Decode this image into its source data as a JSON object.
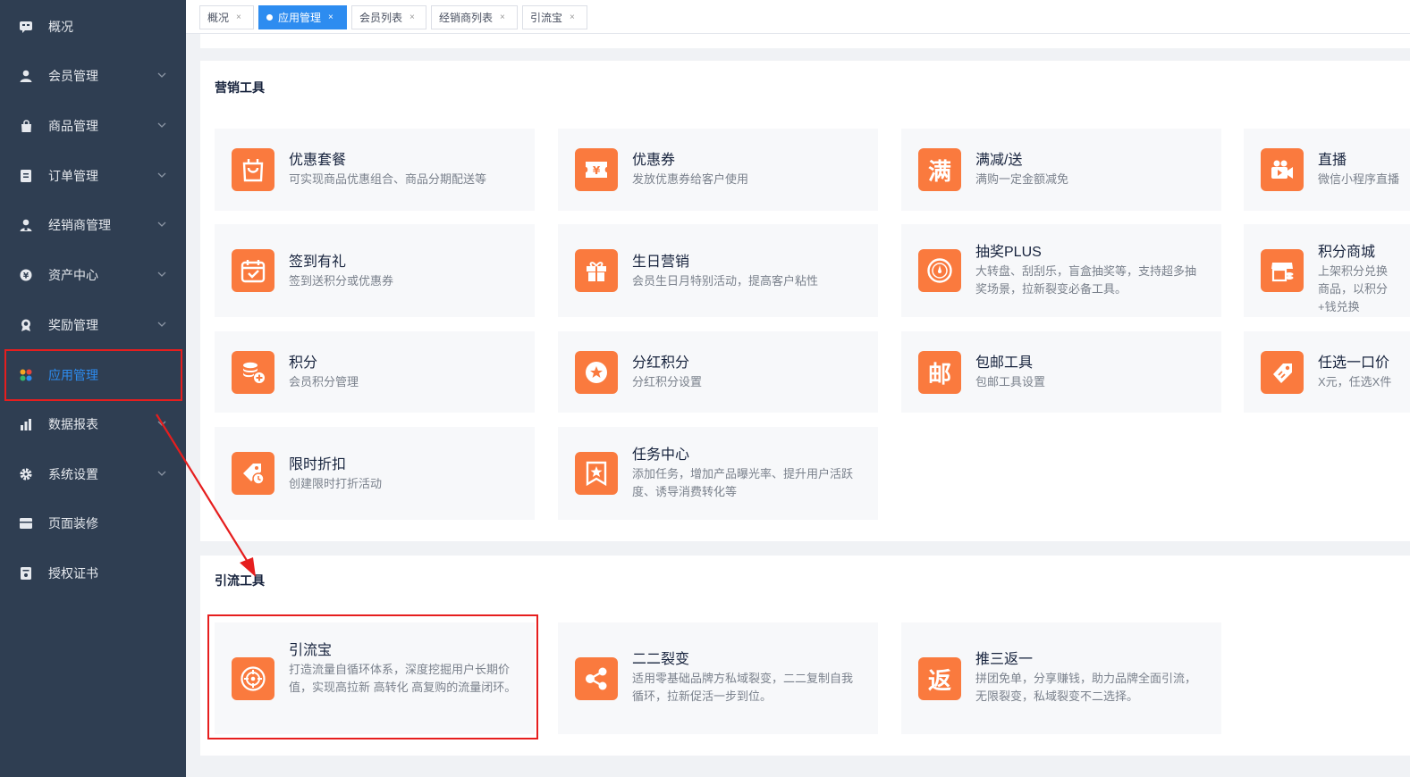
{
  "sidebar": {
    "items": [
      {
        "label": "概况",
        "icon": "overview-icon"
      },
      {
        "label": "会员管理",
        "icon": "user-icon"
      },
      {
        "label": "商品管理",
        "icon": "bag-icon"
      },
      {
        "label": "订单管理",
        "icon": "order-icon"
      },
      {
        "label": "经销商管理",
        "icon": "dealer-icon"
      },
      {
        "label": "资产中心",
        "icon": "asset-icon"
      },
      {
        "label": "奖励管理",
        "icon": "reward-icon"
      },
      {
        "label": "应用管理",
        "icon": "apps-icon"
      },
      {
        "label": "数据报表",
        "icon": "chart-icon"
      },
      {
        "label": "系统设置",
        "icon": "gear-icon"
      },
      {
        "label": "页面装修",
        "icon": "page-icon"
      },
      {
        "label": "授权证书",
        "icon": "certificate-icon"
      }
    ],
    "active_color": "#2d8cf0"
  },
  "tabs": [
    {
      "label": "概况"
    },
    {
      "label": "应用管理"
    },
    {
      "label": "会员列表"
    },
    {
      "label": "经销商列表"
    },
    {
      "label": "引流宝"
    }
  ],
  "marketing": {
    "title": "营销工具",
    "cards": [
      {
        "title": "优惠套餐",
        "desc": "可实现商品优惠组合、商品分期配送等",
        "icon": "package-icon"
      },
      {
        "title": "优惠券",
        "desc": "发放优惠券给客户使用",
        "icon": "coupon-icon"
      },
      {
        "title": "满减/送",
        "desc": "满购一定金额减免",
        "icon": "full-reduce-icon",
        "glyph": "满"
      },
      {
        "title": "直播",
        "desc": "微信小程序直播",
        "icon": "live-camera-icon"
      },
      {
        "title": "签到有礼",
        "desc": "签到送积分或优惠券",
        "icon": "calendar-check-icon"
      },
      {
        "title": "生日营销",
        "desc": "会员生日月特别活动，提高客户粘性",
        "icon": "gift-icon"
      },
      {
        "title": "抽奖PLUS",
        "desc": "大转盘、刮刮乐，盲盒抽奖等，支持超多抽奖场景，拉新裂变必备工具。",
        "icon": "lottery-wheel-icon"
      },
      {
        "title": "积分商城",
        "desc": "上架积分兑换商品，以积分+钱兑换",
        "icon": "points-mall-icon"
      },
      {
        "title": "积分",
        "desc": "会员积分管理",
        "icon": "coins-icon"
      },
      {
        "title": "分红积分",
        "desc": "分红积分设置",
        "icon": "star-badge-icon"
      },
      {
        "title": "包邮工具",
        "desc": "包邮工具设置",
        "icon": "free-shipping-icon",
        "glyph": "邮"
      },
      {
        "title": "任选一口价",
        "desc": "X元，任选X件",
        "icon": "price-tag-icon"
      },
      {
        "title": "限时折扣",
        "desc": "创建限时打折活动",
        "icon": "discount-clock-icon"
      },
      {
        "title": "任务中心",
        "desc": "添加任务，增加产品曝光率、提升用户活跃度、诱导消费转化等",
        "icon": "task-star-icon"
      }
    ]
  },
  "traffic": {
    "title": "引流工具",
    "cards": [
      {
        "title": "引流宝",
        "desc": "打造流量自循环体系，深度挖掘用户长期价值，实现高拉新 高转化 高复购的流量闭环。",
        "icon": "target-icon"
      },
      {
        "title": "二二裂变",
        "desc": "适用零基础品牌方私域裂变，二二复制自我循环，拉新促活一步到位。",
        "icon": "share-icon"
      },
      {
        "title": "推三返一",
        "desc": "拼团免单，分享赚钱，助力品牌全面引流，无限裂变，私域裂变不二选择。",
        "icon": "rebate-icon",
        "glyph": "返"
      }
    ]
  },
  "colors": {
    "sidebar_bg": "#2f3e52",
    "icon_orange": "#fa7a3e",
    "highlight_red": "#e61e1e"
  }
}
